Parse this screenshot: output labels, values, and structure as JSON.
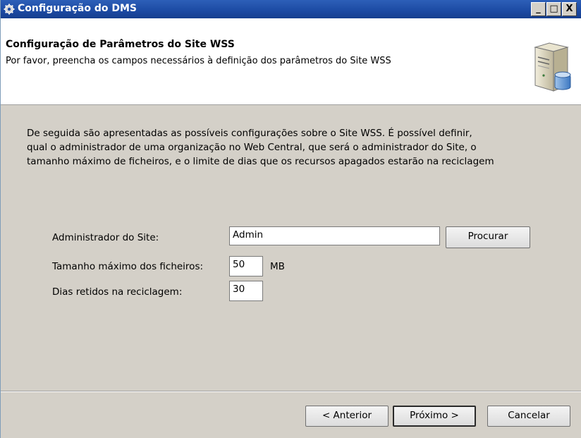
{
  "window": {
    "title": "Configuração do DMS",
    "buttons": {
      "minimize": "_",
      "maximize": "□",
      "close": "X"
    }
  },
  "header": {
    "title": "Configuração de Parâmetros do Site WSS",
    "subtitle": "Por favor, preencha os campos necessários à definição dos parâmetros do Site WSS",
    "icon": "server-icon"
  },
  "intro": {
    "line1": "De seguida são apresentadas as possíveis configurações sobre o Site WSS. É possível definir,",
    "line2": "qual o administrador de uma organização no Web Central, que será o administrador do Site, o",
    "line3": "tamanho máximo de ficheiros, e o limite de dias que os recursos apagados estarão na reciclagem"
  },
  "form": {
    "admin_label": "Administrador do Site:",
    "admin_value": "Admin",
    "browse_label": "Procurar",
    "max_size_label": "Tamanho máximo dos ficheiros:",
    "max_size_value": "50",
    "max_size_unit": "MB",
    "retention_label": "Dias retidos na reciclagem:",
    "retention_value": "30"
  },
  "footer": {
    "back_label": "< Anterior",
    "next_label": "Próximo >",
    "cancel_label": "Cancelar"
  }
}
